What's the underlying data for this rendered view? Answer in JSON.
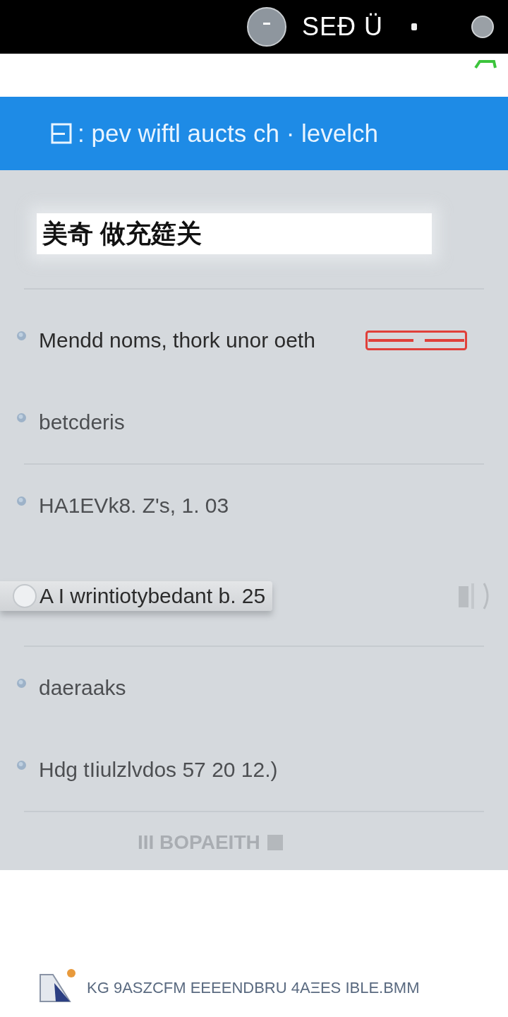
{
  "status_bar": {
    "label": "SEÐ Ü"
  },
  "header": {
    "title": ": pev wiftl aucts ch · levelch"
  },
  "search": {
    "value": "美奇 做充筵关"
  },
  "items": [
    {
      "kind": "badge",
      "label": "Mendd noms, thork unor oeth",
      "divider": false
    },
    {
      "kind": "plain",
      "label": "betcderis",
      "divider": true
    },
    {
      "kind": "plain",
      "label": "HA1EVk8. Z's, 1. 03",
      "divider": false
    },
    {
      "kind": "handle",
      "label": "A I wrintiotybedant b. 25",
      "divider": true
    },
    {
      "kind": "plain",
      "label": "daeraaks",
      "divider": false
    },
    {
      "kind": "plain",
      "label": "Hdg tIiulzlvdos 57 20 12.)",
      "divider": true
    },
    {
      "kind": "faded",
      "label": "III BOPAEITH",
      "divider": false
    }
  ],
  "footer": {
    "text": "KG 9ASZCFM EEEENDBRU 4AΞES IBLE.BMM"
  }
}
